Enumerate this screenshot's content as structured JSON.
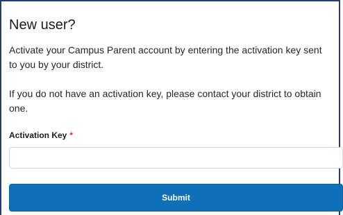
{
  "card": {
    "title": "New user?",
    "paragraph1": "Activate your Campus Parent account by entering the activation key sent to you by your district.",
    "paragraph2": "If you do not have an activation key, please contact your district to obtain one."
  },
  "form": {
    "activation_key_label": "Activation Key",
    "required_marker": "*",
    "activation_key_value": "",
    "submit_label": "Submit"
  },
  "colors": {
    "frame_border": "#1f3f7a",
    "submit_background": "#0f6fb8",
    "required_star": "#c0392b"
  }
}
